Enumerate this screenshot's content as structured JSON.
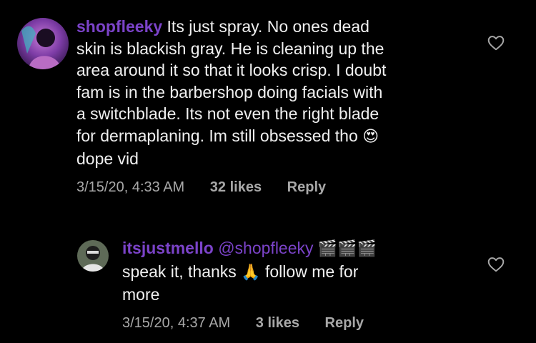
{
  "comments": [
    {
      "username": "shopfleeky",
      "text_lines": [
        "Its just spray. No ones dead",
        "skin is blackish gray. He is cleaning up the",
        "area around it so that it looks crisp. I doubt",
        "fam is in the barbershop doing facials with",
        "a switchblade. Its not even the right blade",
        "for dermaplaning. Im still obsessed tho",
        "dope vid"
      ],
      "emoji": "😍",
      "timestamp": "3/15/20, 4:33 AM",
      "likes": "32 likes",
      "reply_label": "Reply",
      "like_icon": "heart-outline-icon"
    },
    {
      "username": "itsjustmello",
      "mention": "@shopfleeky",
      "emoji_after_mention": "🎬🎬🎬",
      "text_part1": "speak it, thanks",
      "emoji_mid": "🙏",
      "text_part2": "follow me for",
      "text_line3": "more",
      "timestamp": "3/15/20, 4:37 AM",
      "likes": "3 likes",
      "reply_label": "Reply",
      "like_icon": "heart-outline-icon"
    }
  ],
  "colors": {
    "background": "#000000",
    "username": "#7b43c9",
    "meta": "#a8a8a8",
    "text": "#f0f0f0"
  }
}
